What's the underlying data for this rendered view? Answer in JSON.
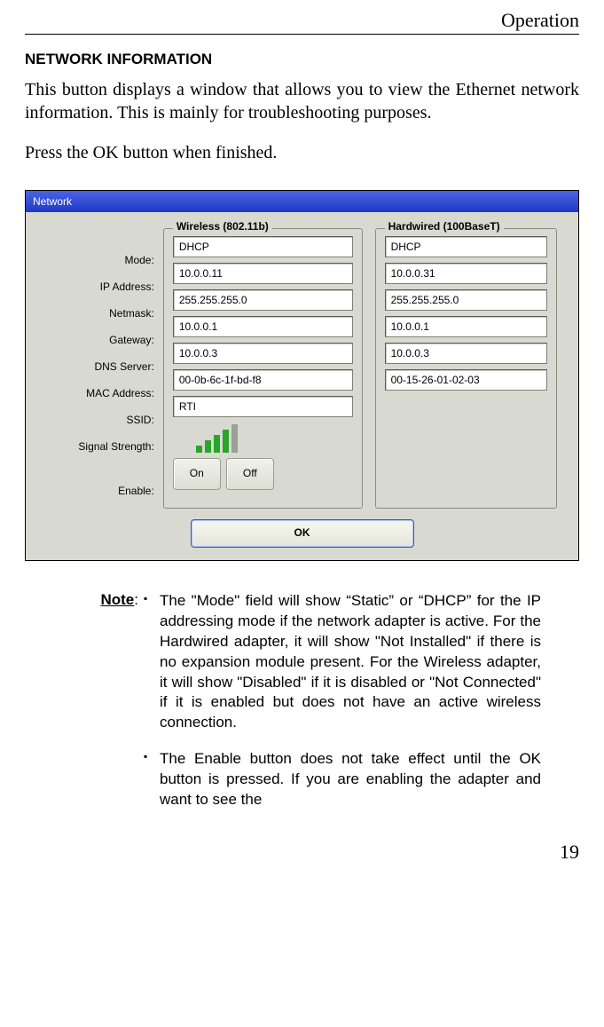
{
  "header": {
    "running": "Operation"
  },
  "section": {
    "title": "NETWORK INFORMATION",
    "p1": "This button displays a window that allows you to view the Ethernet network information. This is mainly for troubleshooting purposes.",
    "p2a": "Press the ",
    "p2b": "OK",
    "p2c": " button when finished."
  },
  "dialog": {
    "title": "Network",
    "labels": {
      "mode": "Mode:",
      "ip": "IP Address:",
      "netmask": "Netmask:",
      "gateway": "Gateway:",
      "dns": "DNS Server:",
      "mac": "MAC Address:",
      "ssid": "SSID:",
      "signal": "Signal Strength:",
      "enable": "Enable:"
    },
    "wireless": {
      "title": "Wireless (802.11b)",
      "mode": "DHCP",
      "ip": "10.0.0.11",
      "netmask": "255.255.255.0",
      "gateway": "10.0.0.1",
      "dns": "10.0.0.3",
      "mac": "00-0b-6c-1f-bd-f8",
      "ssid": "RTI"
    },
    "hardwired": {
      "title": "Hardwired (100BaseT)",
      "mode": "DHCP",
      "ip": "10.0.0.31",
      "netmask": "255.255.255.0",
      "gateway": "10.0.0.1",
      "dns": "10.0.0.3",
      "mac": "00-15-26-01-02-03"
    },
    "buttons": {
      "on": "On",
      "off": "Off",
      "ok": "OK"
    }
  },
  "note": {
    "label": "Note",
    "colon": ":",
    "items": [
      "The \"Mode\" field will show “Static” or “DHCP” for the IP addressing mode if the network adapter is active. For the Hardwired adapter, it will show \"Not Installed\" if there is no expansion module present. For the Wireless adapter, it will show \"Disabled\" if it is disabled or \"Not Connected\" if it is enabled but does not have an active wireless connection.",
      "The Enable button does not take effect until the OK button is pressed. If you are enabling the adapter and want to see the"
    ]
  },
  "pagenum": "19"
}
